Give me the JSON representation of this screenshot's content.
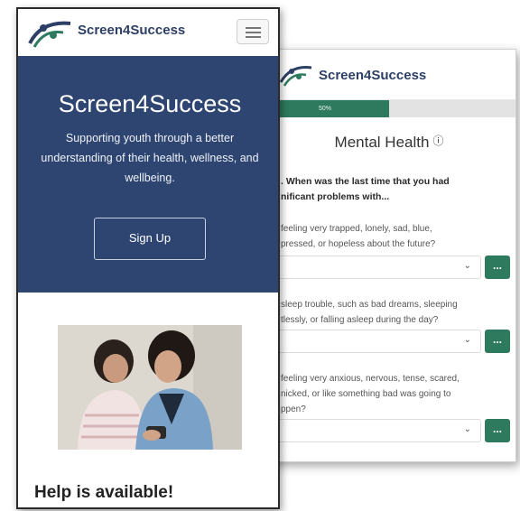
{
  "survey": {
    "brand": "Screen4Success",
    "progress_label": "50%",
    "progress_value": 0.5,
    "section_title": "Mental Health",
    "info_glyph": "ⓘ",
    "question": ". When was the last time that you had\nnificant problems with...",
    "items": [
      {
        "text": " feeling very trapped, lonely, sad, blue,\npressed, or hopeless about the future?"
      },
      {
        "text": " sleep trouble, such as bad dreams, sleeping\ntlessly, or falling asleep during the day?"
      },
      {
        "text": " feeling very anxious, nervous, tense, scared,\nnicked, or like something bad was going to\nppen?"
      }
    ],
    "more_label": "...",
    "accent_color": "#2e7a5e"
  },
  "landing": {
    "brand": "Screen4Success",
    "hero_title": "Screen4Success",
    "hero_subtitle": "Supporting youth through a better understanding of their health, wellness, and wellbeing.",
    "signup_label": "Sign Up",
    "help_heading": "Help is available!",
    "hero_color": "#2e4572"
  }
}
